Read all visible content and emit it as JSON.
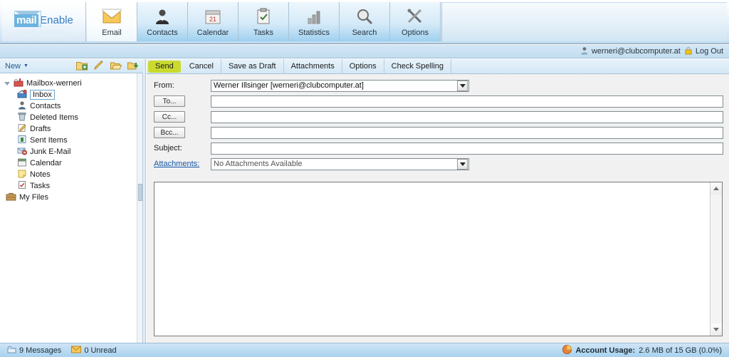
{
  "app": {
    "logo_mail": "mail",
    "logo_enable": "Enable",
    "logo_reflection": "mail Enable"
  },
  "nav": {
    "tabs": [
      {
        "label": "Email",
        "icon": "envelope-icon",
        "active": true
      },
      {
        "label": "Contacts",
        "icon": "person-icon",
        "active": false
      },
      {
        "label": "Calendar",
        "icon": "calendar-icon",
        "active": false
      },
      {
        "label": "Tasks",
        "icon": "clipboard-icon",
        "active": false
      },
      {
        "label": "Statistics",
        "icon": "bar-chart-icon",
        "active": false
      },
      {
        "label": "Search",
        "icon": "magnifier-icon",
        "active": false
      },
      {
        "label": "Options",
        "icon": "tools-icon",
        "active": false
      }
    ]
  },
  "userbar": {
    "account_icon": "user-icon",
    "account": "werneri@clubcomputer.at",
    "logout_icon": "lock-icon",
    "logout": "Log Out"
  },
  "sidebar": {
    "new_button": "New",
    "new_caret": "▼",
    "tools": [
      {
        "name": "new-folder-icon",
        "title": "New Folder"
      },
      {
        "name": "rename-folder-icon",
        "title": "Rename Folder"
      },
      {
        "name": "open-folder-icon",
        "title": "Open Folder"
      },
      {
        "name": "import-folder-icon",
        "title": "Import"
      }
    ],
    "root": {
      "label": "Mailbox-werneri",
      "icon": "mailbox-icon"
    },
    "items": [
      {
        "label": "Inbox",
        "icon": "inbox-icon",
        "selected": true
      },
      {
        "label": "Contacts",
        "icon": "contacts-icon",
        "selected": false
      },
      {
        "label": "Deleted Items",
        "icon": "trash-icon",
        "selected": false
      },
      {
        "label": "Drafts",
        "icon": "drafts-icon",
        "selected": false
      },
      {
        "label": "Sent Items",
        "icon": "sent-icon",
        "selected": false
      },
      {
        "label": "Junk E-Mail",
        "icon": "junk-icon",
        "selected": false
      },
      {
        "label": "Calendar",
        "icon": "calendar-icon",
        "selected": false
      },
      {
        "label": "Notes",
        "icon": "notes-icon",
        "selected": false
      },
      {
        "label": "Tasks",
        "icon": "tasks-icon",
        "selected": false
      }
    ],
    "myfiles": {
      "label": "My Files",
      "icon": "briefcase-icon"
    }
  },
  "compose": {
    "toolbar": [
      {
        "label": "Send",
        "highlighted": true
      },
      {
        "label": "Cancel",
        "highlighted": false
      },
      {
        "label": "Save as Draft",
        "highlighted": false
      },
      {
        "label": "Attachments",
        "highlighted": false
      },
      {
        "label": "Options",
        "highlighted": false
      },
      {
        "label": "Check Spelling",
        "highlighted": false
      }
    ],
    "from_label": "From:",
    "from_value": "Werner Illsinger [werneri@clubcomputer.at]",
    "to_label": "To...",
    "to_value": "",
    "cc_label": "Cc...",
    "cc_value": "",
    "bcc_label": "Bcc...",
    "bcc_value": "",
    "subject_label": "Subject:",
    "subject_value": "",
    "attachments_label": "Attachments:",
    "attachments_value": "No Attachments Available",
    "body_value": ""
  },
  "statusbar": {
    "messages_icon": "mailbox-icon",
    "messages": "9 Messages",
    "unread_icon": "envelope-icon",
    "unread": "0 Unread",
    "usage_icon": "pie-chart-icon",
    "usage_label": "Account Usage:",
    "usage_value": "2.6 MB of 15 GB (0.0%)"
  },
  "colors": {
    "send_highlight": "#cada2e",
    "header_blue": "#9fd0ef",
    "link_blue": "#1556a6"
  }
}
